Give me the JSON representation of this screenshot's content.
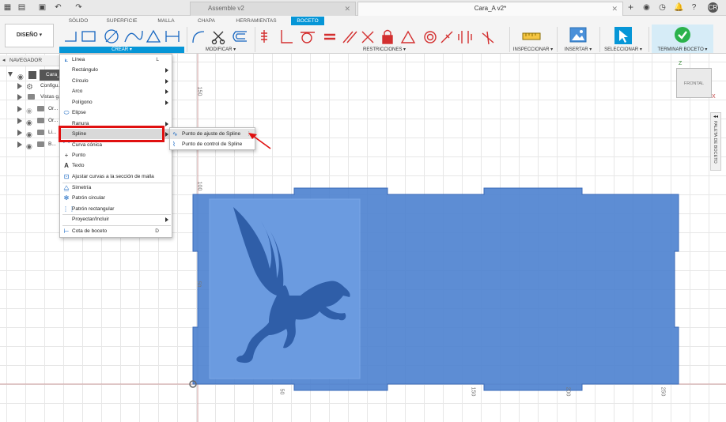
{
  "titlebar": {
    "tabs": [
      {
        "label": "Assemble v2",
        "active": false
      },
      {
        "label": "Cara_A v2*",
        "active": true
      }
    ],
    "user_initials": "CR"
  },
  "ribbon": {
    "workspace": "DISEÑO",
    "tabs": [
      "SÓLIDO",
      "SUPERFICIE",
      "MALLA",
      "CHAPA",
      "HERRAMIENTAS",
      "BOCETO"
    ],
    "active_tab": "BOCETO",
    "groups": [
      "CREAR",
      "MODIFICAR",
      "RESTRICCIONES",
      "INSPECCIONAR",
      "INSERTAR",
      "SELECCIONAR",
      "TERMINAR BOCETO"
    ]
  },
  "navigator": {
    "title": "NAVEGADOR",
    "items": [
      "Cara_...",
      "Configu...",
      "Vistas g...",
      "Or...",
      "Or...",
      "Li...",
      "B..."
    ]
  },
  "create_menu": {
    "items": [
      {
        "label": "Línea",
        "shortcut": "L",
        "icon": "line-icon"
      },
      {
        "label": "Rectángulo",
        "submenu": true
      },
      {
        "label": "Círculo",
        "submenu": true
      },
      {
        "label": "Arco",
        "submenu": true
      },
      {
        "label": "Polígono",
        "submenu": true
      },
      {
        "label": "Elipse",
        "icon": "ellipse-icon"
      },
      {
        "label": "Ranura",
        "submenu": true
      },
      {
        "label": "Spline",
        "submenu": true,
        "highlighted": true
      },
      {
        "label": "Curva cónica",
        "icon": "conic-icon"
      },
      {
        "label": "Punto",
        "icon": "point-icon"
      },
      {
        "label": "Texto",
        "icon": "text-icon"
      },
      {
        "label": "Ajustar curvas a la sección de malla",
        "icon": "mesh-fit-icon"
      },
      {
        "label": "Simetría",
        "icon": "mirror-icon"
      },
      {
        "label": "Patrón circular",
        "icon": "circular-pattern-icon"
      },
      {
        "label": "Patrón rectangular",
        "icon": "rect-pattern-icon"
      },
      {
        "label": "Proyectar/Incluir",
        "submenu": true
      },
      {
        "label": "Cota de boceto",
        "shortcut": "D",
        "icon": "dimension-icon"
      }
    ]
  },
  "spline_submenu": {
    "items": [
      "Punto de ajuste de Spline",
      "Punto de control de Spline"
    ]
  },
  "viewcube": {
    "face": "FRONTAL",
    "axis_z": "Z",
    "axis_x": "X"
  },
  "sketch_palette": {
    "label": "PALETA DE BOCETO"
  },
  "canvas": {
    "vertical_ticks": [
      "150",
      "100",
      "50"
    ],
    "horizontal_ticks": [
      "50",
      "150",
      "200",
      "250"
    ]
  },
  "colors": {
    "accent": "#0696d7",
    "sketch_fill": "#4f83d0",
    "panel_fill": "#6b9be0",
    "graphic": "#2f5ea8",
    "highlight": "#e01010",
    "finish_green": "#2bb24c"
  }
}
